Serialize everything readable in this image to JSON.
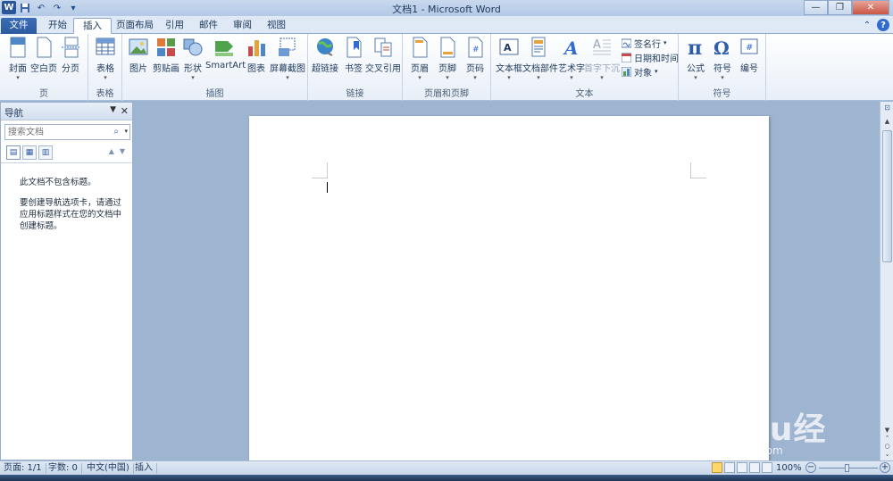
{
  "window": {
    "title": "文档1 - Microsoft Word",
    "app_icon": "W"
  },
  "tabs": [
    {
      "label": "文件"
    },
    {
      "label": "开始"
    },
    {
      "label": "插入"
    },
    {
      "label": "页面布局"
    },
    {
      "label": "引用"
    },
    {
      "label": "邮件"
    },
    {
      "label": "审阅"
    },
    {
      "label": "视图"
    }
  ],
  "active_tab": "插入",
  "ribbon": {
    "groups": {
      "pages": "页",
      "tables": "表格",
      "illustrations": "插图",
      "links": "链接",
      "header_footer": "页眉和页脚",
      "text": "文本",
      "symbols": "符号"
    },
    "buttons": {
      "cover": "封面",
      "blank": "空白页",
      "page_break": "分页",
      "table": "表格",
      "picture": "图片",
      "clipart": "剪贴画",
      "shapes": "形状",
      "smartart": "SmartArt",
      "chart": "图表",
      "screenshot": "屏幕截图",
      "hyperlink": "超链接",
      "bookmark": "书签",
      "cross_ref": "交叉引用",
      "header": "页眉",
      "footer": "页脚",
      "page_number": "页码",
      "textbox": "文本框",
      "quick_parts": "文档部件",
      "wordart": "艺术字",
      "dropcap": "首字下沉",
      "signature": "签名行",
      "datetime": "日期和时间",
      "object": "对象",
      "equation": "公式",
      "symbol": "符号",
      "number": "编号"
    }
  },
  "nav_pane": {
    "title": "导航",
    "search_placeholder": "搜索文档",
    "msg1": "此文档不包含标题。",
    "msg2": "要创建导航选项卡，请通过应用标题样式在您的文档中创建标题。"
  },
  "status": {
    "page": "页面: 1/1",
    "words": "字数: 0",
    "language": "中文(中国)",
    "mode": "插入",
    "zoom": "100%",
    "zoom_level": 1.0
  },
  "watermark": {
    "brand": "Baidu经验",
    "url": "jingyan.baidu.com"
  },
  "colors": {
    "file_tab": "#2c5aa0",
    "ribbon_bg": "#ffffff",
    "doc_bg": "#9eb5d1",
    "accent": "#2f6bd0"
  }
}
